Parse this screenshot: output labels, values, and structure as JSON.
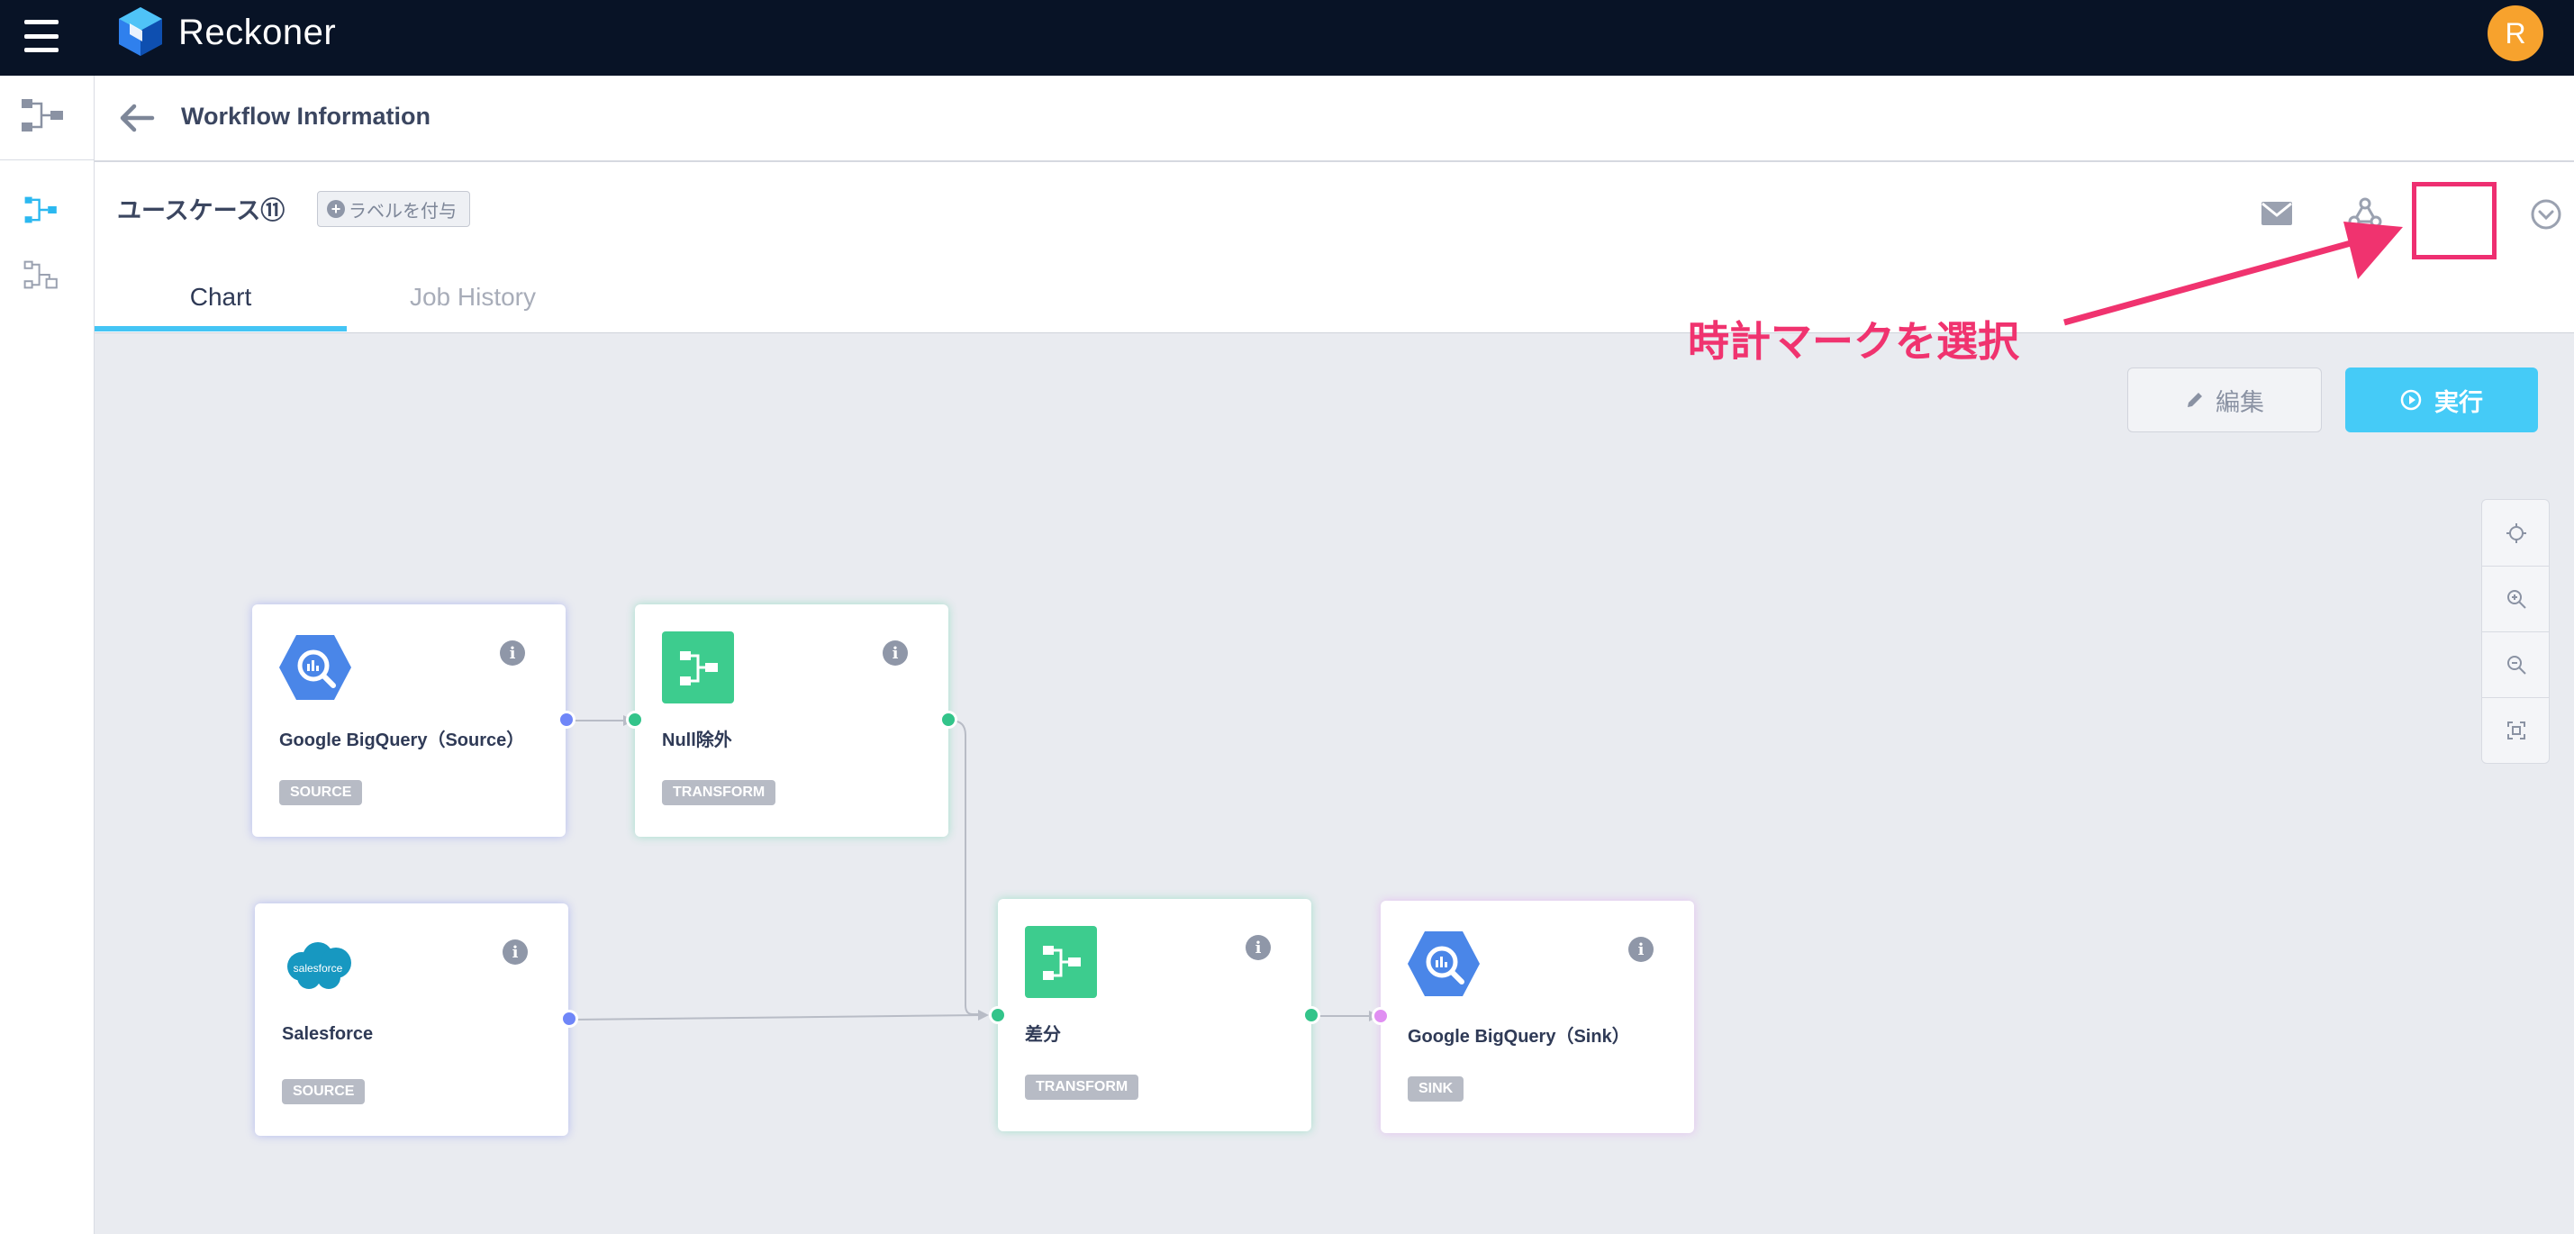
{
  "app": {
    "brand": "Reckoner",
    "avatar_initial": "R"
  },
  "colors": {
    "topbar": "#081326",
    "accent": "#45cbf7",
    "annotation": "#f0336f",
    "avatar": "#f7a22d"
  },
  "header": {
    "title": "Workflow Information"
  },
  "workflow": {
    "name": "ユースケース⑪",
    "add_label": "ラベルを付与"
  },
  "tabs": [
    {
      "label": "Chart",
      "active": true
    },
    {
      "label": "Job History",
      "active": false
    }
  ],
  "toolbar": {
    "edit_label": "編集",
    "run_label": "実行"
  },
  "annotation": {
    "text": "時計マークを選択"
  },
  "icons": {
    "top_right": [
      "mail-icon",
      "webhook-icon",
      "clock-icon",
      "gear-icon"
    ],
    "zoom": [
      "crosshair-icon",
      "zoom-in-icon",
      "zoom-out-icon",
      "fit-screen-icon"
    ]
  },
  "nodes": [
    {
      "label": "Google BigQuery（Source）",
      "type": "SOURCE",
      "icon": "bigquery-icon"
    },
    {
      "label": "Null除外",
      "type": "TRANSFORM",
      "icon": "transform-icon"
    },
    {
      "label": "Salesforce",
      "type": "SOURCE",
      "icon": "salesforce-icon",
      "logo_text": "salesforce"
    },
    {
      "label": "差分",
      "type": "TRANSFORM",
      "icon": "transform-icon"
    },
    {
      "label": "Google BigQuery（Sink）",
      "type": "SINK",
      "icon": "bigquery-icon"
    }
  ]
}
